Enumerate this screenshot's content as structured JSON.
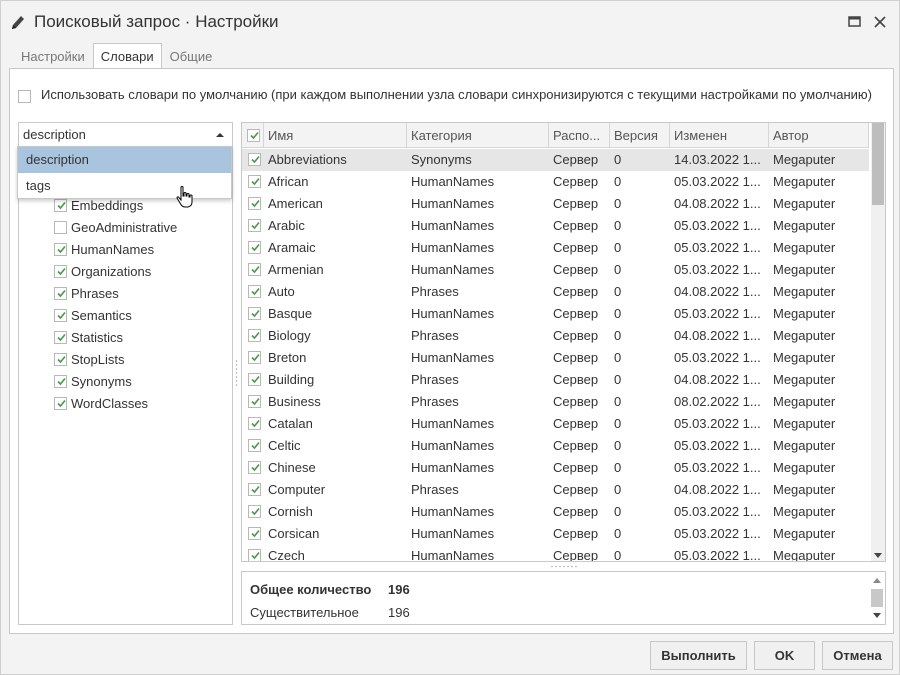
{
  "window": {
    "title": "Поисковый запрос · Настройки",
    "icons": {
      "title": "pencil-icon",
      "maximize": "maximize-icon",
      "close": "close-icon"
    }
  },
  "tabs": [
    {
      "label": "Настройки",
      "active": false
    },
    {
      "label": "Словари",
      "active": true
    },
    {
      "label": "Общие",
      "active": false
    }
  ],
  "use_default": {
    "checked": false,
    "label": "Использовать словари по умолчанию (при каждом выполнении узла словари синхронизируются с текущими настройками по умолчанию)"
  },
  "group_combo": {
    "value": "description",
    "options": [
      {
        "label": "description",
        "selected": true
      },
      {
        "label": "tags",
        "selected": false
      }
    ]
  },
  "tree": [
    {
      "label": "Embeddings",
      "checked": true
    },
    {
      "label": "GeoAdministrative",
      "checked": false
    },
    {
      "label": "HumanNames",
      "checked": true
    },
    {
      "label": "Organizations",
      "checked": true
    },
    {
      "label": "Phrases",
      "checked": true
    },
    {
      "label": "Semantics",
      "checked": true
    },
    {
      "label": "Statistics",
      "checked": true
    },
    {
      "label": "StopLists",
      "checked": true
    },
    {
      "label": "Synonyms",
      "checked": true
    },
    {
      "label": "WordClasses",
      "checked": true
    }
  ],
  "grid": {
    "columns": [
      "Имя",
      "Категория",
      "Распо...",
      "Версия",
      "Изменен",
      "Автор"
    ],
    "rows": [
      {
        "name": "Abbreviations",
        "category": "Synonyms",
        "location": "Сервер",
        "version": "0",
        "modified": "14.03.2022 1...",
        "author": "Megaputer",
        "checked": true,
        "selected": true
      },
      {
        "name": "African",
        "category": "HumanNames",
        "location": "Сервер",
        "version": "0",
        "modified": "05.03.2022 1...",
        "author": "Megaputer",
        "checked": true,
        "selected": false
      },
      {
        "name": "American",
        "category": "HumanNames",
        "location": "Сервер",
        "version": "0",
        "modified": "04.08.2022 1...",
        "author": "Megaputer",
        "checked": true,
        "selected": false
      },
      {
        "name": "Arabic",
        "category": "HumanNames",
        "location": "Сервер",
        "version": "0",
        "modified": "05.03.2022 1...",
        "author": "Megaputer",
        "checked": true,
        "selected": false
      },
      {
        "name": "Aramaic",
        "category": "HumanNames",
        "location": "Сервер",
        "version": "0",
        "modified": "05.03.2022 1...",
        "author": "Megaputer",
        "checked": true,
        "selected": false
      },
      {
        "name": "Armenian",
        "category": "HumanNames",
        "location": "Сервер",
        "version": "0",
        "modified": "05.03.2022 1...",
        "author": "Megaputer",
        "checked": true,
        "selected": false
      },
      {
        "name": "Auto",
        "category": "Phrases",
        "location": "Сервер",
        "version": "0",
        "modified": "04.08.2022 1...",
        "author": "Megaputer",
        "checked": true,
        "selected": false
      },
      {
        "name": "Basque",
        "category": "HumanNames",
        "location": "Сервер",
        "version": "0",
        "modified": "05.03.2022 1...",
        "author": "Megaputer",
        "checked": true,
        "selected": false
      },
      {
        "name": "Biology",
        "category": "Phrases",
        "location": "Сервер",
        "version": "0",
        "modified": "04.08.2022 1...",
        "author": "Megaputer",
        "checked": true,
        "selected": false
      },
      {
        "name": "Breton",
        "category": "HumanNames",
        "location": "Сервер",
        "version": "0",
        "modified": "05.03.2022 1...",
        "author": "Megaputer",
        "checked": true,
        "selected": false
      },
      {
        "name": "Building",
        "category": "Phrases",
        "location": "Сервер",
        "version": "0",
        "modified": "04.08.2022 1...",
        "author": "Megaputer",
        "checked": true,
        "selected": false
      },
      {
        "name": "Business",
        "category": "Phrases",
        "location": "Сервер",
        "version": "0",
        "modified": "08.02.2022 1...",
        "author": "Megaputer",
        "checked": true,
        "selected": false
      },
      {
        "name": "Catalan",
        "category": "HumanNames",
        "location": "Сервер",
        "version": "0",
        "modified": "05.03.2022 1...",
        "author": "Megaputer",
        "checked": true,
        "selected": false
      },
      {
        "name": "Celtic",
        "category": "HumanNames",
        "location": "Сервер",
        "version": "0",
        "modified": "05.03.2022 1...",
        "author": "Megaputer",
        "checked": true,
        "selected": false
      },
      {
        "name": "Chinese",
        "category": "HumanNames",
        "location": "Сервер",
        "version": "0",
        "modified": "05.03.2022 1...",
        "author": "Megaputer",
        "checked": true,
        "selected": false
      },
      {
        "name": "Computer",
        "category": "Phrases",
        "location": "Сервер",
        "version": "0",
        "modified": "04.08.2022 1...",
        "author": "Megaputer",
        "checked": true,
        "selected": false
      },
      {
        "name": "Cornish",
        "category": "HumanNames",
        "location": "Сервер",
        "version": "0",
        "modified": "05.03.2022 1...",
        "author": "Megaputer",
        "checked": true,
        "selected": false
      },
      {
        "name": "Corsican",
        "category": "HumanNames",
        "location": "Сервер",
        "version": "0",
        "modified": "05.03.2022 1...",
        "author": "Megaputer",
        "checked": true,
        "selected": false
      },
      {
        "name": "Czech",
        "category": "HumanNames",
        "location": "Сервер",
        "version": "0",
        "modified": "05.03.2022 1...",
        "author": "Megaputer",
        "checked": true,
        "selected": false
      }
    ]
  },
  "summary": [
    {
      "label": "Общее количество",
      "value": "196",
      "bold": true
    },
    {
      "label": "Существительное",
      "value": "196",
      "bold": false
    }
  ],
  "buttons": {
    "run": "Выполнить",
    "ok": "OK",
    "cancel": "Отмена"
  },
  "colors": {
    "check": "#4a9a4a",
    "selection": "#a9c4de",
    "row_selected": "#e6e6e6"
  }
}
